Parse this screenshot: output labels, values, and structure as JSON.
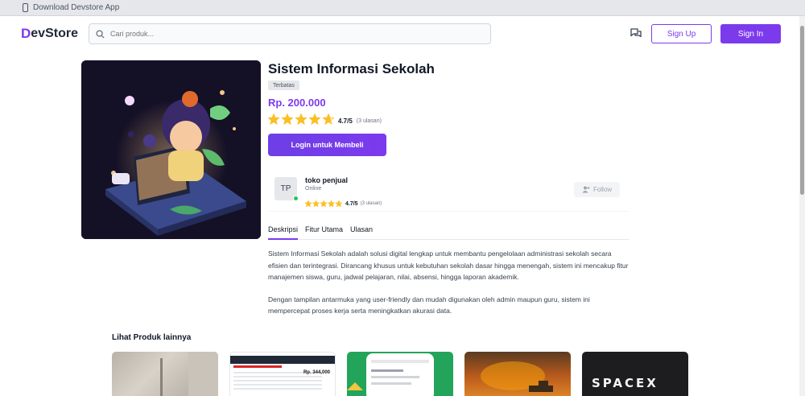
{
  "topbar": {
    "text": "Download Devstore App"
  },
  "header": {
    "logo_mark": "D",
    "logo_text": "evStore",
    "search_placeholder": "Cari produk...",
    "signup_label": "Sign Up",
    "signin_label": "Sign In"
  },
  "product": {
    "title": "Sistem Informasi Sekolah",
    "badge": "Terbatas",
    "price": "Rp. 200.000",
    "rating_value": 4.7,
    "rating_text": "4.7/5",
    "rating_count": "(3 ulasan)",
    "buy_label": "Login untuk Membeli"
  },
  "seller": {
    "initials": "TP",
    "name": "toko penjual",
    "status": "Online",
    "rating_value": 4.7,
    "rating_text": "4.7/5",
    "rating_count": "(3 ulasan)",
    "follow_label": "Follow"
  },
  "tabs": [
    {
      "label": "Deskripsi",
      "active": true
    },
    {
      "label": "Fitur Utama",
      "active": false
    },
    {
      "label": "Ulasan",
      "active": false
    }
  ],
  "description": [
    "Sistem Informasi Sekolah adalah solusi digital lengkap untuk membantu pengelolaan administrasi sekolah secara efisien dan terintegrasi. Dirancang khusus untuk kebutuhan sekolah dasar hingga menengah, sistem ini mencakup fitur manajemen siswa, guru, jadwal pelajaran, nilai, absensi, hingga laporan akademik.",
    "Dengan tampilan antarmuka yang user-friendly dan mudah digunakan oleh admin maupun guru, sistem ini mempercepat proses kerja serta meningkatkan akurasi data."
  ],
  "related": {
    "title": "Lihat Produk lainnya",
    "card2_price": "Rp. 344,000",
    "card5_text": "SPACEX"
  },
  "colors": {
    "accent": "#7c3aed",
    "star": "#fbbf24",
    "online": "#22c55e"
  }
}
